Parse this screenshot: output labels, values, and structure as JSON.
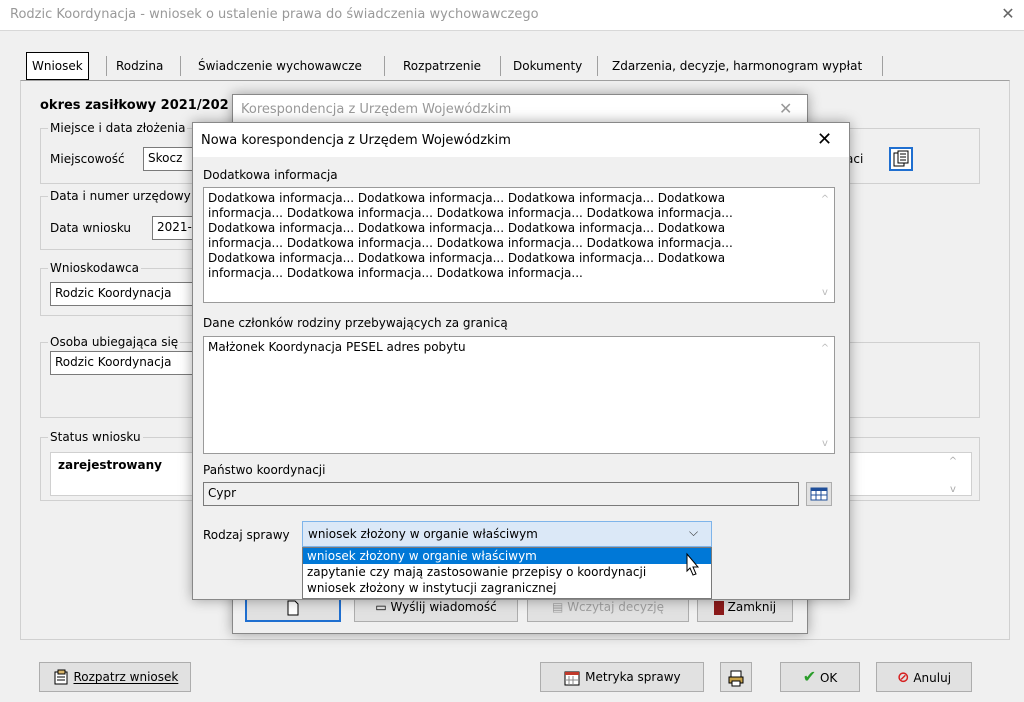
{
  "window": {
    "title": "Rodzic Koordynacja - wniosek o ustalenie prawa do świadczenia wychowawczego",
    "close_icon": "close-icon"
  },
  "tabs": [
    {
      "label": "Wniosek"
    },
    {
      "label": "Rodzina"
    },
    {
      "label": "Świadczenie wychowawcze"
    },
    {
      "label": "Rozpatrzenie"
    },
    {
      "label": "Dokumenty"
    },
    {
      "label": "Zdarzenia, decyzje, harmonogram wypłat"
    }
  ],
  "main": {
    "period_label": "okres zasiłkowy 2021/202",
    "place_group": "Miejsce i data złożenia",
    "miejscowosc_label": "Miejscowość",
    "miejscowosc_value": "Skocz",
    "aci_label": "aci",
    "date_group": "Data i numer urzędowy",
    "date_label": "Data wniosku",
    "date_value": "2021-",
    "applicant_group": "Wnioskodawca",
    "applicant_value": "Rodzic Koordynacja",
    "person_group": "Osoba ubiegająca się",
    "person_value": "Rodzic Koordynacja",
    "status_group": "Status wniosku",
    "status_value": "zarejestrowany"
  },
  "bottom": {
    "rozpatrz": "Rozpatrz wniosek",
    "metryka": "Metryka sprawy",
    "ok": "OK",
    "anuluj": "Anuluj"
  },
  "back_dialog": {
    "title": "Korespondencja z Urzędem Wojewódzkim",
    "send_label": "Wyślij wiadomość",
    "load_label": "Wczytaj decyzję",
    "close_label": "Zamknij"
  },
  "dialog": {
    "title": "Nowa korespondencja z Urzędem Wojewódzkim",
    "info_label": "Dodatkowa informacja",
    "info_lines": [
      "Dodatkowa informacja... Dodatkowa informacja... Dodatkowa informacja... Dodatkowa",
      "informacja... Dodatkowa informacja... Dodatkowa informacja... Dodatkowa informacja...",
      "Dodatkowa informacja... Dodatkowa informacja... Dodatkowa informacja... Dodatkowa",
      "informacja... Dodatkowa informacja... Dodatkowa informacja... Dodatkowa informacja...",
      "Dodatkowa informacja... Dodatkowa informacja... Dodatkowa informacja... Dodatkowa",
      "informacja... Dodatkowa informacja... Dodatkowa informacja..."
    ],
    "family_label": "Dane członków rodziny przebywających za granicą",
    "family_value": "Małżonek Koordynacja PESEL adres pobytu",
    "country_label": "Państwo koordynacji",
    "country_value": "Cypr",
    "type_label": "Rodzaj sprawy",
    "type_selected": "wniosek złożony w organie właściwym",
    "type_options": [
      "wniosek złożony w organie właściwym",
      "zapytanie czy mają zastosowanie przepisy o koordynacji",
      "wniosek złożony w instytucji zagranicznej"
    ]
  },
  "colors": {
    "accent": "#0078d7",
    "dropdown_bg": "#dbe8f7"
  }
}
